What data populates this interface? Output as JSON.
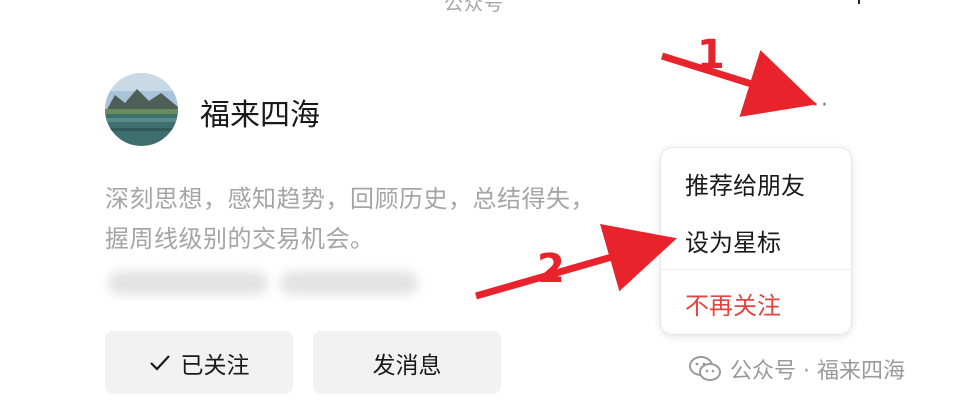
{
  "header": {
    "title": "公众号"
  },
  "account": {
    "name": "福来四海",
    "description": "深刻思想，感知趋势，回顾历史，总结得失，把握周线级别的交易机会。",
    "description_line1": "深刻思想，感知趋势，回顾历史，总结得失，",
    "description_line2": "握周线级别的交易机会。"
  },
  "more_menu": {
    "icon": "more-icon",
    "label": "···"
  },
  "buttons": {
    "follow_label": "已关注",
    "message_label": "发消息"
  },
  "popup_menu": {
    "items": [
      "推荐给朋友",
      "设为星标",
      "不再关注"
    ]
  },
  "annotations": {
    "step1": "1",
    "step2": "2"
  },
  "watermark": {
    "text": "公众号 · 福来四海"
  },
  "colors": {
    "danger": "#e64340",
    "arrow": "#e8232b",
    "muted": "#a5a5a5"
  }
}
